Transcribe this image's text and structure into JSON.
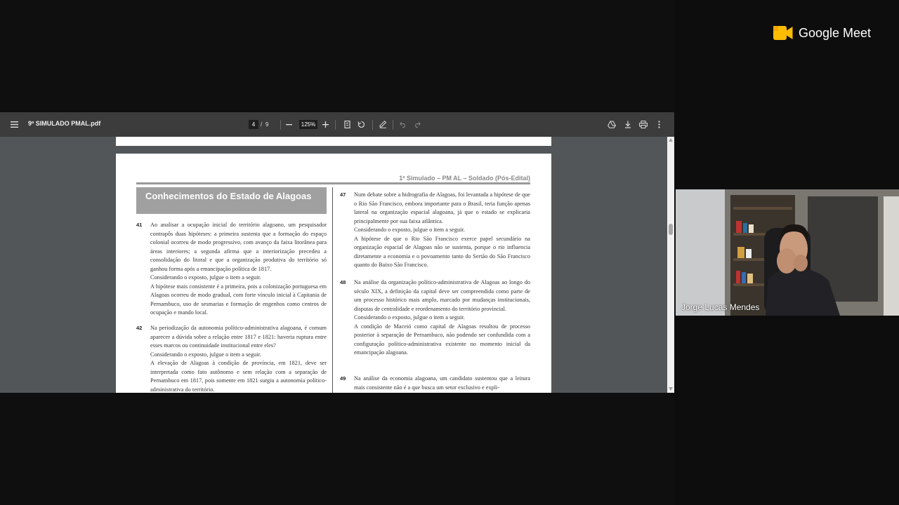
{
  "pdf": {
    "filename": "9º SIMULADO PMAL.pdf",
    "current_page": "4",
    "page_separator": "/",
    "total_pages": "9",
    "zoom": "125%"
  },
  "document": {
    "header": "1º Simulado – PM AL – Soldado (Pós-Edital)",
    "section_title": "Conhecimentos do Estado de Alagoas",
    "questions": [
      {
        "number": "41",
        "paragraphs": [
          "Ao analisar a ocupação inicial do território alagoano, um pesquisador contrapôs duas hipóteses: a primeira sustenta que a formação do espaço colonial ocorreu de modo progressivo, com avanço da faixa litorânea para áreas interiores; a segunda afirma que a interiorização precedeu a consolidação do litoral e que a organização produtiva do território só ganhou forma após a emancipação política de 1817.",
          "Considerando o exposto, julgue o item a seguir.",
          "A hipótese mais consistente é a primeira, pois a colonização portuguesa em Alagoas ocorreu de modo gradual, com forte vínculo inicial à Capitania de Pernambuco, uso de sesmarias e formação de engenhos como centros de ocupação e mando local."
        ]
      },
      {
        "number": "42",
        "paragraphs": [
          "Na periodização da autonomia político-administrativa alagoana, é comum aparecer a dúvida sobre a relação entre 1817 e 1821: haveria ruptura entre esses marcos ou continuidade institucional entre eles?",
          "Considerando o exposto, julgue o item a seguir.",
          "A elevação de Alagoas à condição de província, em 1821, deve ser interpretada como fato autônomo e sem relação com a separação de Pernambuco em 1817, pois somente em 1821 surgiu a autonomia político-administrativa do território."
        ]
      },
      {
        "number": "47",
        "paragraphs": [
          "Num debate sobre a hidrografia de Alagoas, foi levantada a hipótese de que o Rio São Francisco, embora importante para o Brasil, teria função apenas lateral na organização espacial alagoana, já que o estado se explicaria principalmente por sua faixa atlântica.",
          "Considerando o exposto, julgue o item a seguir.",
          "A hipótese de que o Rio São Francisco exerce papel secundário na organização espacial de Alagoas não se sustenta, porque o rio influencia diretamente a economia e o povoamento tanto do Sertão do São Francisco quanto do Baixo São Francisco."
        ]
      },
      {
        "number": "48",
        "paragraphs": [
          "Na análise da organização político-administrativa de Alagoas ao longo do século XIX, a definição da capital deve ser compreendida como parte de um processo histórico mais amplo, marcado por mudanças institucionais, disputas de centralidade e reordenamento do território provincial.",
          "Considerando o exposto, julgue o item a seguir.",
          "A condição de Maceió como capital de Alagoas resultou de processo posterior à separação de Pernambuco, não podendo ser confundida com a configuração político-administrativa existente no momento inicial da emancipação alagoana."
        ]
      },
      {
        "number": "49",
        "paragraphs": [
          "Na análise da economia alagoana, um candidato sustentou que a leitura mais consistente não é a que busca um setor exclusivo e expli-"
        ]
      }
    ]
  },
  "meet": {
    "brand": "Google Meet",
    "participant_name": "Jorge Lucas Mendes"
  },
  "colors": {
    "toolbar": "#3c3c3c",
    "viewer_bg": "#525659",
    "banner": "#a0a0a0",
    "meet_yellow": "#fbbc04"
  }
}
